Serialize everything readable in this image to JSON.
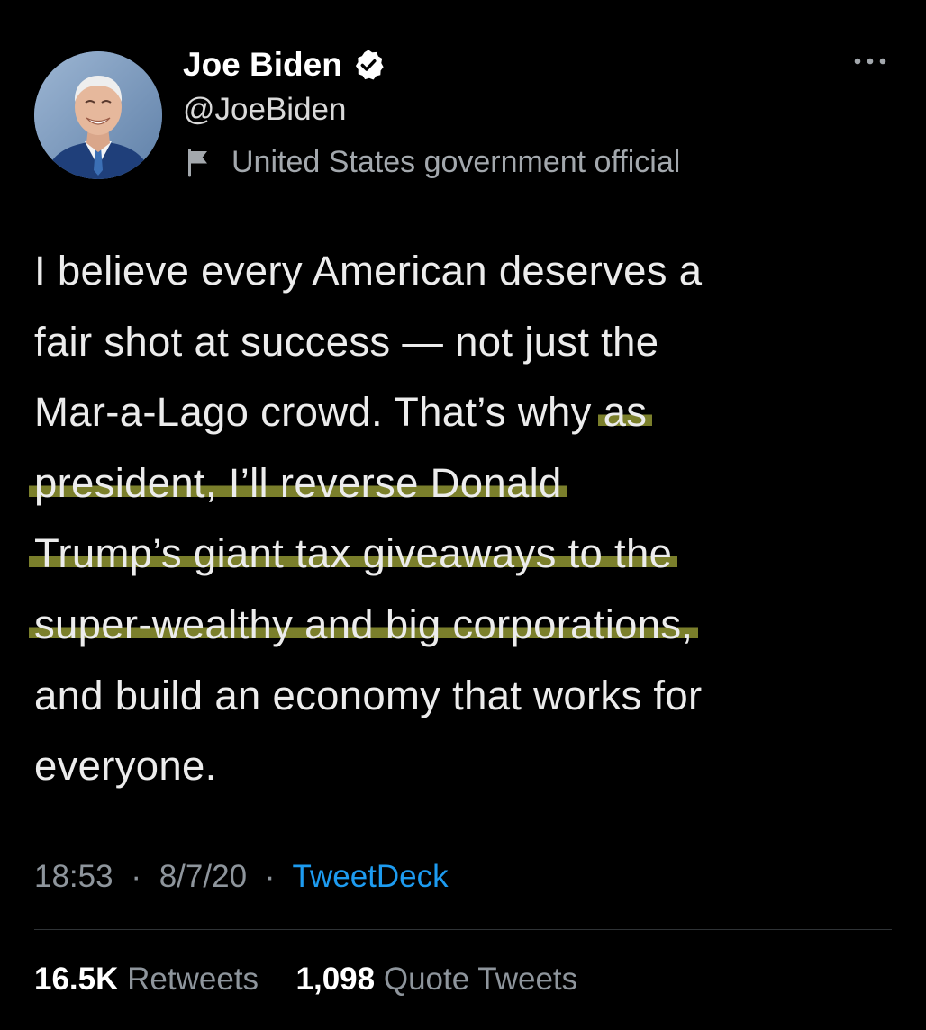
{
  "author": {
    "name": "Joe Biden",
    "handle": "@JoeBiden",
    "label": "United States government official",
    "verified_icon": "verified-badge-icon",
    "label_icon": "flag-icon",
    "avatar": "profile-photo"
  },
  "menu": {
    "icon": "more-icon"
  },
  "tweet": {
    "lines": [
      {
        "pre": "I believe every American deserves a",
        "hl": "",
        "post": ""
      },
      {
        "pre": "fair shot at success — not just the",
        "hl": "",
        "post": ""
      },
      {
        "pre": "Mar-a-Lago crowd. That’s why ",
        "hl": "as",
        "post": ""
      },
      {
        "pre": "",
        "hl": "president, I’ll reverse Donald",
        "post": ""
      },
      {
        "pre": "",
        "hl": "Trump’s giant tax giveaways to the",
        "post": ""
      },
      {
        "pre": "",
        "hl": "super-wealthy and big corporations,",
        "post": ""
      },
      {
        "pre": "and build an economy that works for",
        "hl": "",
        "post": ""
      },
      {
        "pre": "everyone.",
        "hl": "",
        "post": ""
      }
    ],
    "time": "18:53",
    "date": "8/7/20",
    "separator": "·",
    "source": "TweetDeck"
  },
  "stats": {
    "retweets_count": "16.5K",
    "retweets_label": "Retweets",
    "quotes_count": "1,098",
    "quotes_label": "Quote Tweets"
  },
  "colors": {
    "background": "#000000",
    "text": "#e7e9ea",
    "secondary": "#8e959c",
    "link": "#1d9bf0",
    "verified": "#ffffff",
    "highlight": "#aab03c"
  }
}
